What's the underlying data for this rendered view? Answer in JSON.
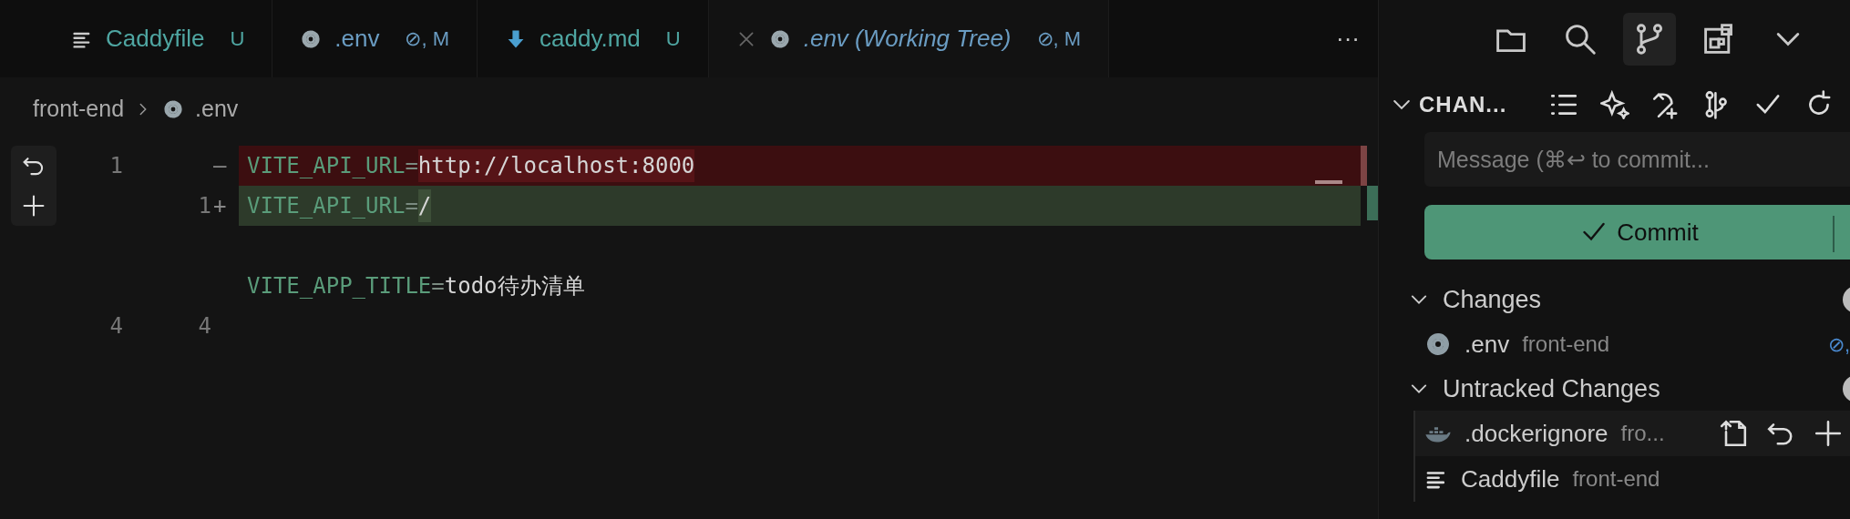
{
  "tabs": [
    {
      "label": "Caddyfile",
      "kind": "text",
      "badge": "U",
      "color": "#4fa6a2",
      "selected": false,
      "preview": false
    },
    {
      "label": ".env",
      "kind": "config",
      "badge": "⊘, M",
      "color": "#6a9cc2",
      "selected": false,
      "preview": false
    },
    {
      "label": "caddy.md",
      "kind": "markdown",
      "badge": "U",
      "color": "#4fa6a2",
      "selected": false,
      "preview": false
    },
    {
      "label": ".env (Working Tree)",
      "kind": "config",
      "badge": "⊘, M",
      "color": "#6a9cc2",
      "selected": true,
      "preview": true
    }
  ],
  "tab_more": "···",
  "breadcrumb": [
    {
      "label": "front-end"
    },
    {
      "label": ".env",
      "kind": "config"
    }
  ],
  "diff_lines": [
    {
      "kind": "removed",
      "old": "1",
      "marker": "—",
      "key": "VITE_API_URL=",
      "value": "http://localhost:8000"
    },
    {
      "kind": "added",
      "new": "1",
      "marker": "+",
      "key": "VITE_API_URL=",
      "value": "/"
    },
    {
      "kind": "blank"
    },
    {
      "kind": "context",
      "key": "VITE_APP_TITLE=",
      "value": "todo待办清单"
    },
    {
      "kind": "context",
      "old": "4",
      "new": "4"
    }
  ],
  "activity": [
    {
      "kind": "folder",
      "selected": false
    },
    {
      "kind": "search",
      "selected": false
    },
    {
      "kind": "branch",
      "selected": true
    },
    {
      "kind": "extensions",
      "selected": false
    },
    {
      "kind": "chevron",
      "selected": false
    }
  ],
  "scm": {
    "title": "CHAN...",
    "expanded": true,
    "message_placeholder": "Message (⌘↩ to commit...",
    "commit_label": "Commit",
    "groups": [
      {
        "label": "Changes",
        "expanded": true,
        "items": [
          {
            "name": ".env",
            "path": "front-end",
            "kind": "config",
            "status": "⊘,",
            "hovered": false
          }
        ]
      },
      {
        "label": "Untracked Changes",
        "expanded": true,
        "items": [
          {
            "name": ".dockerignore",
            "path": "fro...",
            "kind": "docker",
            "hovered": true
          },
          {
            "name": "Caddyfile",
            "path": "front-end",
            "kind": "text",
            "hovered": false
          }
        ]
      }
    ]
  }
}
